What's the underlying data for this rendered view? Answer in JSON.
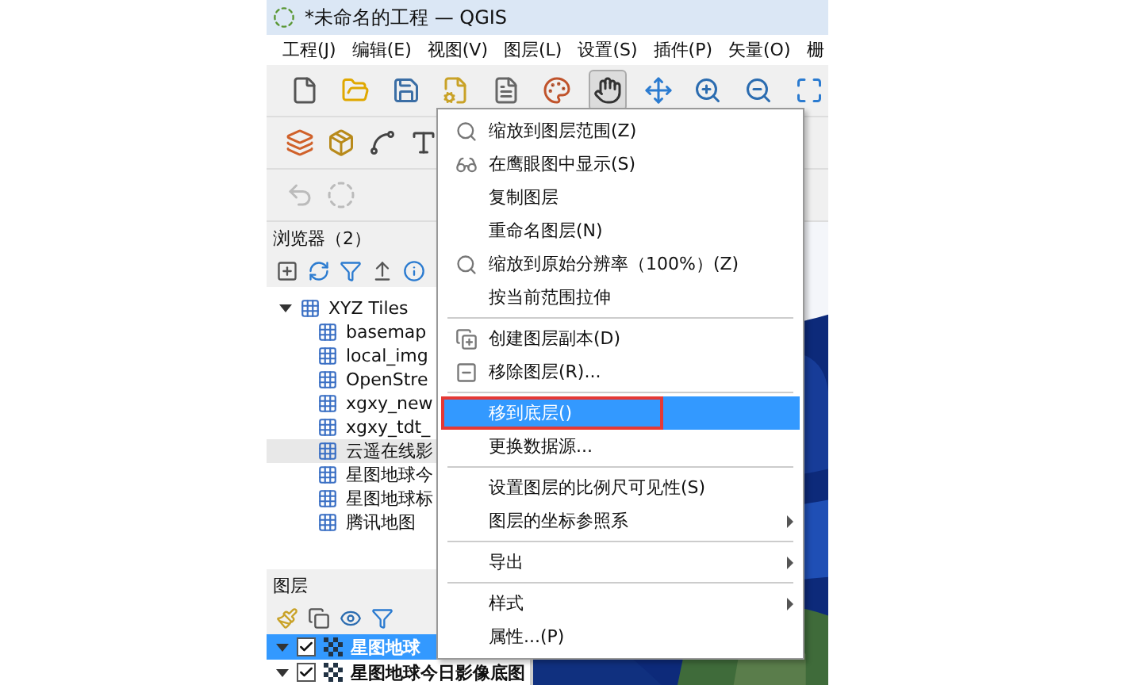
{
  "window": {
    "title": "*未命名的工程 — QGIS"
  },
  "menu_bar": [
    "工程(J)",
    "编辑(E)",
    "视图(V)",
    "图层(L)",
    "设置(S)",
    "插件(P)",
    "矢量(O)",
    "栅"
  ],
  "toolbar": [
    {
      "kind": "new",
      "selected": false
    },
    {
      "kind": "open",
      "selected": false
    },
    {
      "kind": "save",
      "selected": false
    },
    {
      "kind": "layout",
      "selected": false
    },
    {
      "kind": "manager",
      "selected": false
    },
    {
      "kind": "style",
      "selected": false
    },
    {
      "kind": "pan",
      "selected": true
    },
    {
      "kind": "pan-selection",
      "selected": false
    },
    {
      "kind": "zoom-in",
      "selected": false
    },
    {
      "kind": "zoom-out",
      "selected": false
    },
    {
      "kind": "zoom-full",
      "selected": false
    }
  ],
  "browser": {
    "title": "浏览器（2）",
    "tree": [
      {
        "label": "XYZ Tiles",
        "expanded": true,
        "selected": false,
        "children": [
          {
            "label": "basemap",
            "selected": false
          },
          {
            "label": "local_img",
            "selected": false
          },
          {
            "label": "OpenStre",
            "selected": false
          },
          {
            "label": "xgxy_new",
            "selected": false
          },
          {
            "label": "xgxy_tdt_",
            "selected": false
          },
          {
            "label": "云遥在线影",
            "selected": true
          },
          {
            "label": "星图地球今",
            "selected": false
          },
          {
            "label": "星图地球标",
            "selected": false
          },
          {
            "label": "腾讯地图",
            "selected": false
          }
        ]
      }
    ]
  },
  "layers": {
    "title": "图层",
    "rows": [
      {
        "label": "星图地球",
        "checked": true,
        "expanded": true,
        "selected": true
      },
      {
        "label": "星图地球今日影像底图",
        "checked": true,
        "expanded": true,
        "selected": false
      }
    ]
  },
  "context_menu": {
    "items": [
      {
        "kind": "item",
        "label": "缩放到图层范围(Z)",
        "selected": false,
        "submenu": false,
        "outlined": false
      },
      {
        "kind": "item",
        "label": "在鹰眼图中显示(S)",
        "selected": false,
        "submenu": false,
        "outlined": false
      },
      {
        "kind": "item",
        "label": "复制图层",
        "selected": false,
        "submenu": false,
        "outlined": false
      },
      {
        "kind": "item",
        "label": "重命名图层(N)",
        "selected": false,
        "submenu": false,
        "outlined": false
      },
      {
        "kind": "item",
        "label": "缩放到原始分辨率（100%）(Z)",
        "selected": false,
        "submenu": false,
        "outlined": false
      },
      {
        "kind": "item",
        "label": "按当前范围拉伸",
        "selected": false,
        "submenu": false,
        "outlined": false
      },
      {
        "kind": "separator"
      },
      {
        "kind": "item",
        "label": "创建图层副本(D)",
        "selected": false,
        "submenu": false,
        "outlined": false
      },
      {
        "kind": "item",
        "label": "移除图层(R)...",
        "selected": false,
        "submenu": false,
        "outlined": false
      },
      {
        "kind": "separator"
      },
      {
        "kind": "item",
        "label": "移到底层()",
        "selected": true,
        "submenu": false,
        "outlined": true
      },
      {
        "kind": "item",
        "label": "更换数据源...",
        "selected": false,
        "submenu": false,
        "outlined": false
      },
      {
        "kind": "separator"
      },
      {
        "kind": "item",
        "label": "设置图层的比例尺可见性(S)",
        "selected": false,
        "submenu": false,
        "outlined": false
      },
      {
        "kind": "item",
        "label": "图层的坐标参照系",
        "selected": false,
        "submenu": true,
        "outlined": false
      },
      {
        "kind": "separator"
      },
      {
        "kind": "item",
        "label": "导出",
        "selected": false,
        "submenu": true,
        "outlined": false
      },
      {
        "kind": "separator"
      },
      {
        "kind": "item",
        "label": "样式",
        "selected": false,
        "submenu": true,
        "outlined": false
      },
      {
        "kind": "item",
        "label": "属性...(P)",
        "selected": false,
        "submenu": false,
        "outlined": false
      }
    ]
  }
}
